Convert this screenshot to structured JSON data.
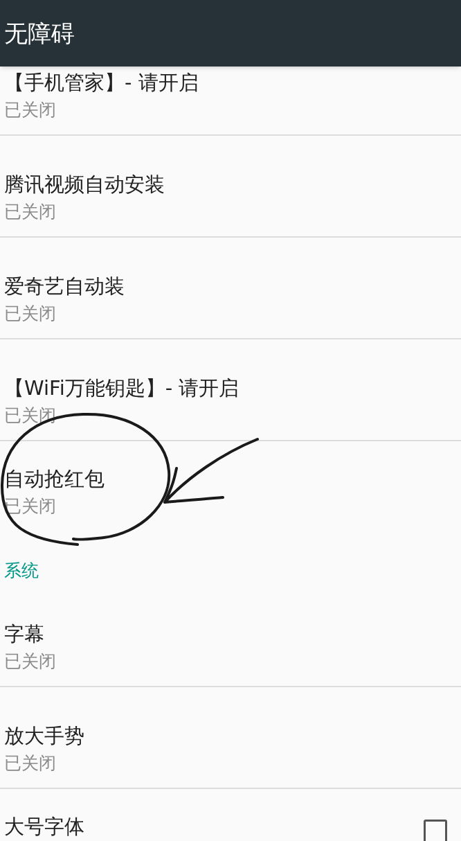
{
  "app_bar": {
    "title": "无障碍"
  },
  "sections": [
    {
      "items": [
        {
          "kind": "summary",
          "title": "【手机管家】- 请开启",
          "summary": "已关闭"
        },
        {
          "kind": "summary",
          "title": "腾讯视频自动安装",
          "summary": "已关闭"
        },
        {
          "kind": "summary",
          "title": "爱奇艺自动装",
          "summary": "已关闭"
        },
        {
          "kind": "summary",
          "title": "【WiFi万能钥匙】- 请开启",
          "summary": "已关闭"
        },
        {
          "kind": "summary",
          "title": "自动抢红包",
          "summary": "已关闭"
        }
      ]
    },
    {
      "header": "系统",
      "items": [
        {
          "kind": "summary",
          "title": "字幕",
          "summary": "已关闭"
        },
        {
          "kind": "summary",
          "title": "放大手势",
          "summary": "已关闭"
        },
        {
          "kind": "checkbox",
          "title": "大号字体",
          "checked": false
        }
      ]
    }
  ]
}
